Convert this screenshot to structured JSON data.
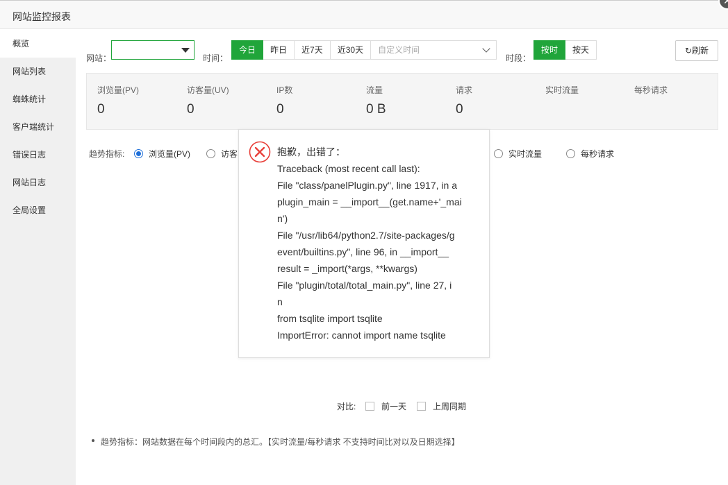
{
  "window": {
    "title": "网站监控报表"
  },
  "sidebar": {
    "items": [
      {
        "label": "概览"
      },
      {
        "label": "网站列表"
      },
      {
        "label": "蜘蛛统计"
      },
      {
        "label": "客户端统计"
      },
      {
        "label": "错误日志"
      },
      {
        "label": "网站日志"
      },
      {
        "label": "全局设置"
      }
    ]
  },
  "toolbar": {
    "site_label": "网站：",
    "site_value": "",
    "time_label": "时间：",
    "time_buttons": [
      "今日",
      "昨日",
      "近7天",
      "近30天"
    ],
    "time_selected": "今日",
    "custom_time_placeholder": "自定义时间",
    "period_label": "时段：",
    "period_buttons": [
      "按时",
      "按天"
    ],
    "period_selected": "按时",
    "refresh_label": "刷新"
  },
  "stats": [
    {
      "label": "浏览量(PV)",
      "value": "0"
    },
    {
      "label": "访客量(UV)",
      "value": "0"
    },
    {
      "label": "IP数",
      "value": "0"
    },
    {
      "label": "流量",
      "value": "0 B"
    },
    {
      "label": "请求",
      "value": "0"
    },
    {
      "label": "实时流量",
      "value": ""
    },
    {
      "label": "每秒请求",
      "value": ""
    }
  ],
  "trend": {
    "label": "趋势指标:",
    "options": [
      "浏览量(PV)",
      "访客",
      "实时流量",
      "每秒请求"
    ],
    "selected": "浏览量(PV)"
  },
  "compare": {
    "label": "对比:",
    "options": [
      "前一天",
      "上周同期"
    ]
  },
  "note": "趋势指标：网站数据在每个时间段内的总汇。【实时流量/每秒请求 不支持时间比对以及日期选择】",
  "error": {
    "lines": [
      "抱歉，出错了：",
      "Traceback (most recent call last):",
      "File \"class/panelPlugin.py\", line 1917, in a",
      "plugin_main = __import__(get.name+'_mai",
      "n')",
      "File \"/usr/lib64/python2.7/site-packages/g",
      "event/builtins.py\", line 96, in __import__",
      "result = _import(*args, **kwargs)",
      "File \"plugin/total/total_main.py\", line 27, i",
      "n",
      "from tsqlite import tsqlite",
      "ImportError: cannot import name tsqlite"
    ]
  },
  "colors": {
    "accent": "#20a53a",
    "error_red": "#e8403a",
    "radio_blue": "#1e6fd9"
  }
}
